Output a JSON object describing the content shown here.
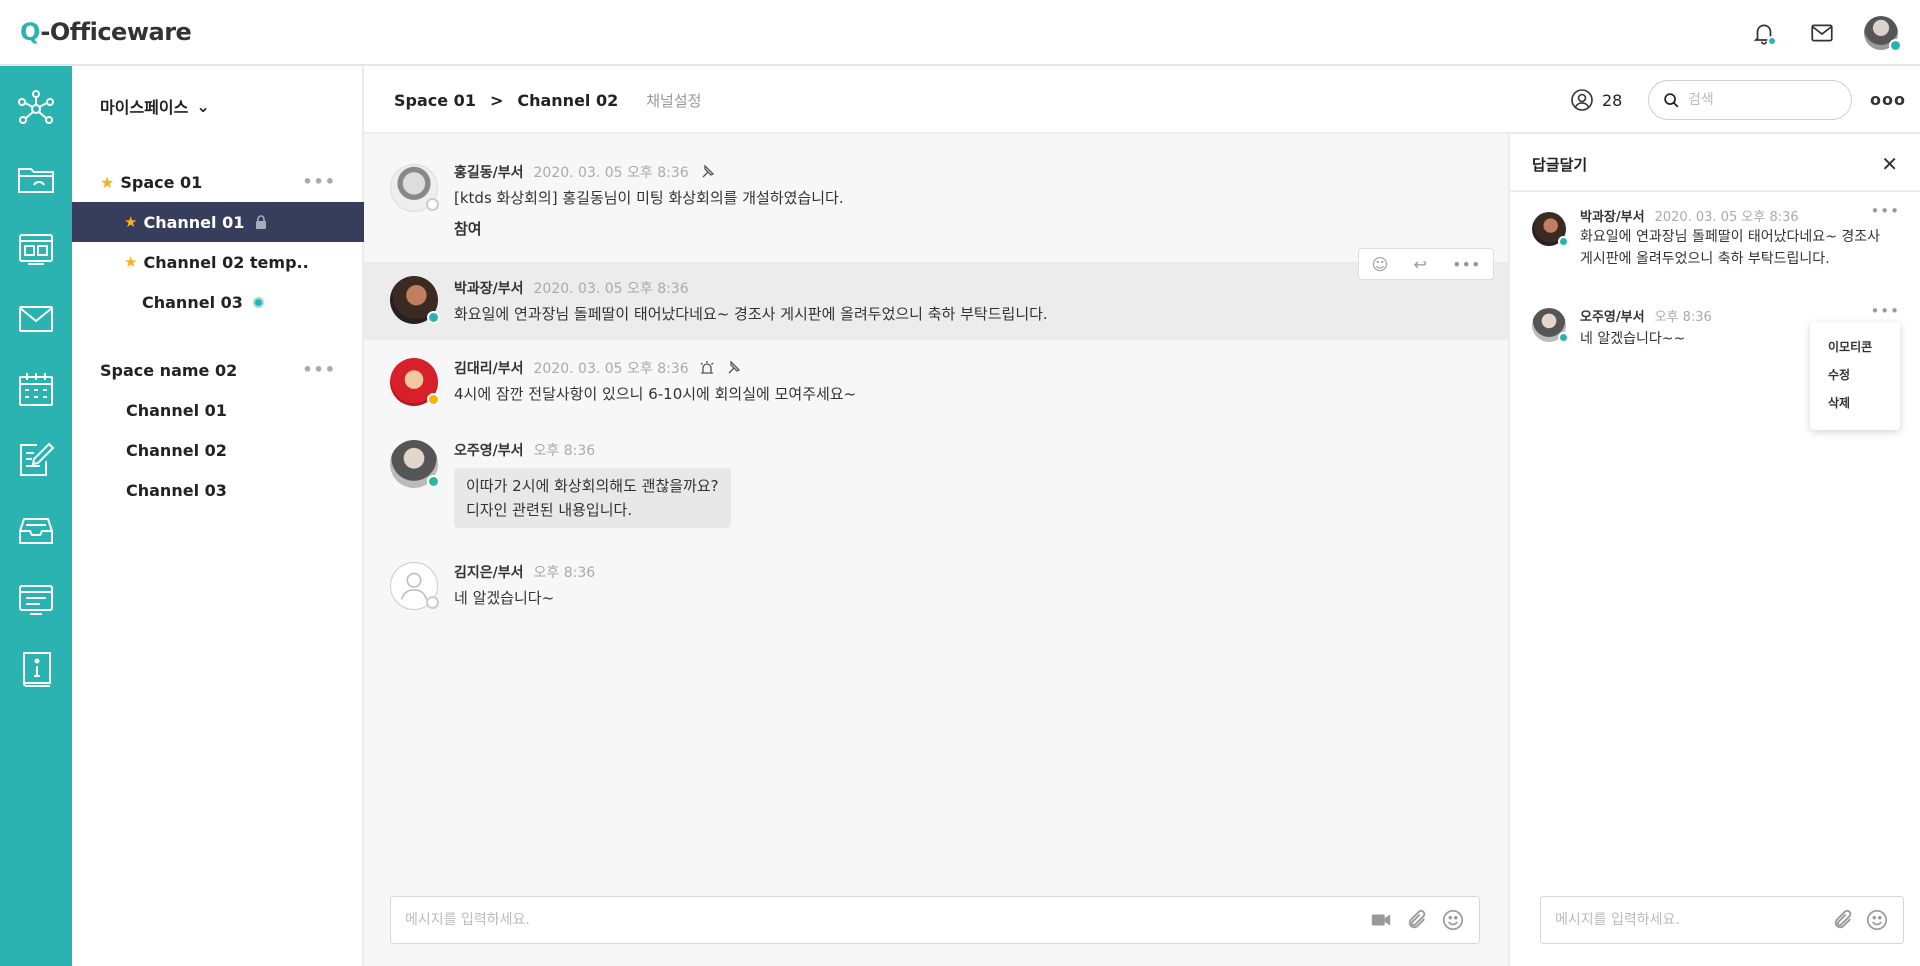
{
  "app": {
    "logo_q": "Q",
    "logo_rest": "-Officeware"
  },
  "colors": {
    "accent": "#2bb3b1",
    "active_channel_bg": "#363e5c",
    "star": "#f6b21b"
  },
  "topbar": {
    "icons": [
      "bell-icon",
      "mail-icon",
      "user-avatar"
    ]
  },
  "rail": {
    "icons": [
      "network-icon",
      "folder-icon",
      "board-icon",
      "mail-icon",
      "calendar-icon",
      "edit-icon",
      "inbox-icon",
      "monitor-icon",
      "info-book-icon"
    ]
  },
  "sidebar": {
    "workspace": "마이스페이스",
    "spaces": [
      {
        "name": "Space 01",
        "starred": true,
        "channels": [
          {
            "name": "Channel 01",
            "starred": true,
            "active": true,
            "locked": true
          },
          {
            "name": "Channel 02 temp..",
            "starred": true
          },
          {
            "name": "Channel 03",
            "unread": true
          }
        ]
      },
      {
        "name": "Space name 02",
        "starred": false,
        "channels": [
          {
            "name": "Channel 01"
          },
          {
            "name": "Channel 02"
          },
          {
            "name": "Channel 03"
          }
        ]
      }
    ]
  },
  "header": {
    "space": "Space 01",
    "separator": ">",
    "channel": "Channel 02",
    "settings": "채널설정",
    "member_count": "28",
    "search_placeholder": "검색"
  },
  "messages": [
    {
      "name": "홍길동/부서",
      "time": "2020. 03. 05 오후 8:36",
      "text": "[ktds 화상회의] 홍길동님이 미팅 화상회의를 개설하였습니다.",
      "text2": "참여"
    },
    {
      "name": "박과장/부서",
      "time": "2020. 03. 05 오후 8:36",
      "text": "화요일에 연과장님 돌페딸이 태어났다네요~ 경조사 게시판에 올려두었으니 축하 부탁드립니다."
    },
    {
      "name": "김대리/부서",
      "time": "2020. 03. 05 오후 8:36",
      "text": "4시에 잠깐 전달사항이 있으니 6-10시에 회의실에 모여주세요~"
    },
    {
      "name": "오주영/부서",
      "time": "오후 8:36",
      "text": "이따가 2시에 화상회의해도 괜찮을까요?",
      "text2": "디자인 관련된 내용입니다."
    },
    {
      "name": "김지은/부서",
      "time": "오후 8:36",
      "text": "네 알겠습니다~"
    }
  ],
  "composer": {
    "placeholder": "메시지를 입력하세요."
  },
  "reply_panel": {
    "title": "답글달기",
    "messages": [
      {
        "name": "박과장/부서",
        "time": "2020. 03. 05 오후 8:36",
        "text": "화요일에 연과장님 돌페딸이 태어났다네요~ 경조사 게시판에 올려두었으니 축하 부탁드립니다."
      },
      {
        "name": "오주영/부서",
        "time": "오후 8:36",
        "text": "네 알겠습니다~~"
      }
    ],
    "context_menu": [
      "이모티콘",
      "수정",
      "삭제"
    ],
    "placeholder": "메시지를 입력하세요."
  }
}
